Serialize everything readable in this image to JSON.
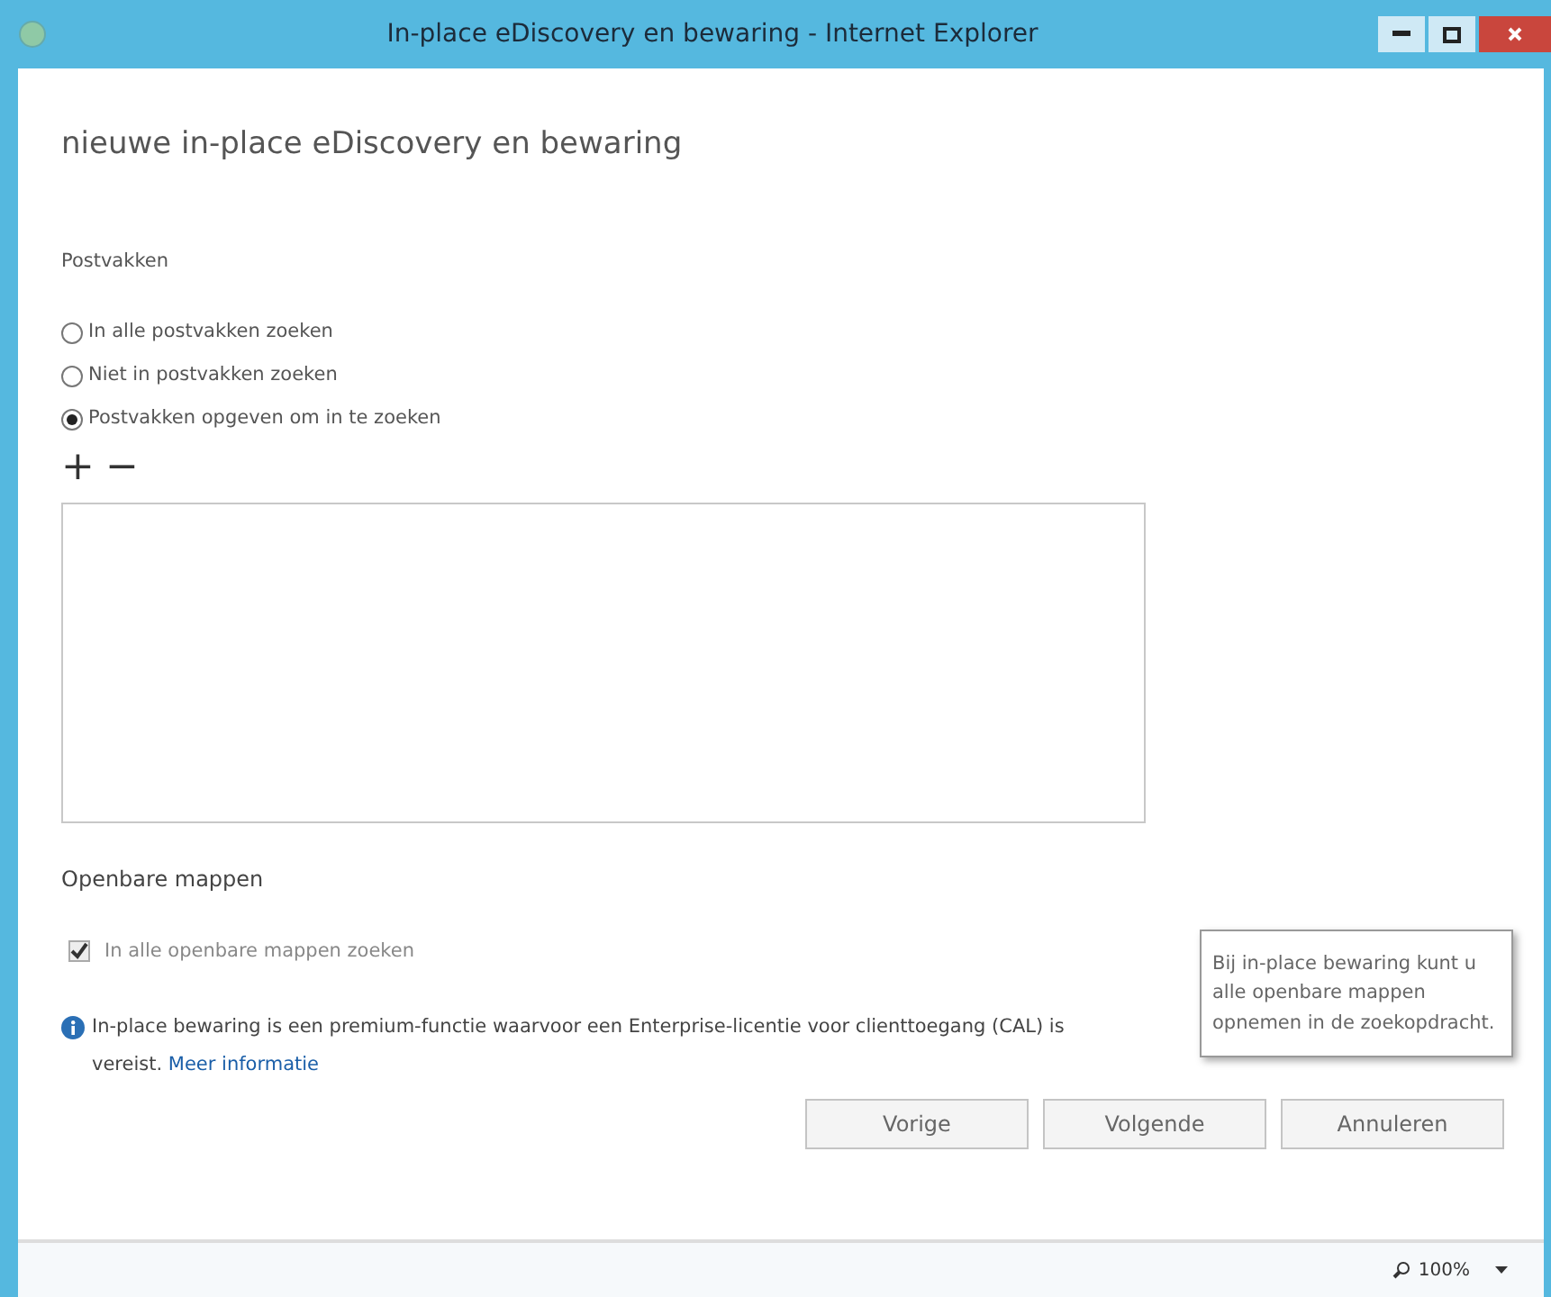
{
  "window": {
    "title": "In-place eDiscovery en bewaring - Internet Explorer"
  },
  "heading": "nieuwe in-place eDiscovery en bewaring",
  "mailboxes": {
    "label": "Postvakken",
    "options": [
      {
        "label": "In alle postvakken zoeken",
        "selected": false
      },
      {
        "label": "Niet in postvakken zoeken",
        "selected": false
      },
      {
        "label": "Postvakken opgeven om in te zoeken",
        "selected": true
      }
    ],
    "toolbar": [
      "+",
      "−"
    ]
  },
  "public_folders": {
    "label": "Openbare mappen",
    "checkbox": {
      "label": "In alle openbare mappen zoeken",
      "checked": true,
      "disabled": true
    }
  },
  "tooltip": "Bij in-place bewaring kunt u alle openbare mappen opnemen in de zoekopdracht.",
  "info": {
    "text": "In-place bewaring is een premium-functie waarvoor een Enterprise-licentie voor clienttoegang (CAL) is vereist.",
    "link": "Meer informatie"
  },
  "buttons": [
    "Vorige",
    "Volgende",
    "Annuleren"
  ],
  "status_bar": {
    "zoom": "100%"
  }
}
